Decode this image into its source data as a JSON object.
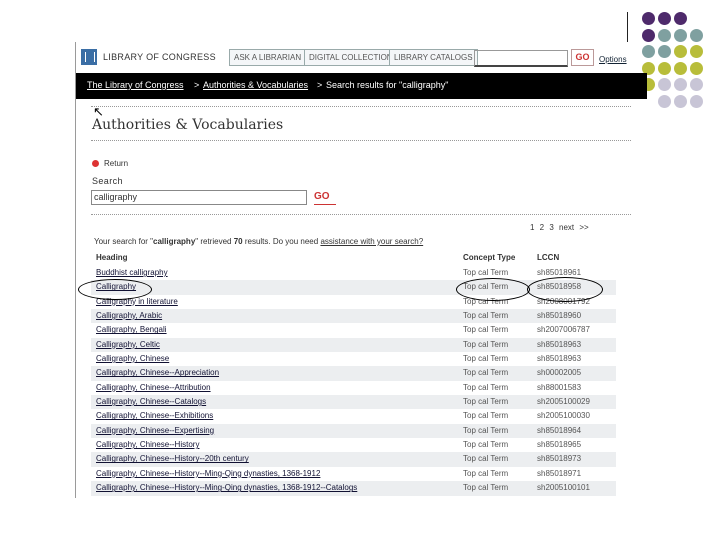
{
  "colors": {
    "purple": "#4e2a6b",
    "teal": "#7fa0a0",
    "olive": "#b8bd3a",
    "lavender": "#c8c5d6"
  },
  "header": {
    "logo_text": "LIBRARY OF CONGRESS",
    "ask": "ASK A LIBRARIAN",
    "digital": "DIGITAL COLLECTIONS",
    "catalogs": "LIBRARY CATALOGS",
    "go": "GO",
    "options": "Options"
  },
  "breadcrumb": {
    "home": "The Library of Congress",
    "sep1": ">",
    "section": "Authorities & Vocabularies",
    "sep2": ">",
    "current": "Search results for \"calligraphy\""
  },
  "main": {
    "title": "Authorities & Vocabularies",
    "return": "Return",
    "search_label": "Search",
    "search_value": "calligraphy",
    "go": "GO"
  },
  "results": {
    "pager": "1 2 3 next >>",
    "summary_a": "Your search for \"",
    "summary_term": "calligraphy",
    "summary_b": "\" retrieved ",
    "summary_count": "70",
    "summary_c": " results. Do you need ",
    "summary_link": "assistance with your search?",
    "col_heading": "Heading",
    "col_type": "Concept Type",
    "col_lccn": "LCCN",
    "rows": [
      {
        "heading": "Buddhist calligraphy",
        "type": "Top cal Term",
        "lccn": "sh85018961"
      },
      {
        "heading": "Calligraphy",
        "type": "Top cal Term",
        "lccn": "sh85018958"
      },
      {
        "heading": "Calligraphy in literature",
        "type": "Top cal Term",
        "lccn": "sh2008001792"
      },
      {
        "heading": "Calligraphy, Arabic",
        "type": "Top cal Term",
        "lccn": "sh85018960"
      },
      {
        "heading": "Calligraphy, Bengali",
        "type": "Top cal Term",
        "lccn": "sh2007006787"
      },
      {
        "heading": "Calligraphy, Celtic",
        "type": "Top cal Term",
        "lccn": "sh85018963"
      },
      {
        "heading": "Calligraphy, Chinese",
        "type": "Top cal Term",
        "lccn": "sh85018963"
      },
      {
        "heading": "Calligraphy, Chinese--Appreciation",
        "type": "Top cal Term",
        "lccn": "sh00002005"
      },
      {
        "heading": "Calligraphy, Chinese--Attribution",
        "type": "Top cal Term",
        "lccn": "sh88001583"
      },
      {
        "heading": "Calligraphy, Chinese--Catalogs",
        "type": "Top cal Term",
        "lccn": "sh2005100029"
      },
      {
        "heading": "Calligraphy, Chinese--Exhibitions",
        "type": "Top cal Term",
        "lccn": "sh2005100030"
      },
      {
        "heading": "Calligraphy, Chinese--Expertising",
        "type": "Top cal Term",
        "lccn": "sh85018964"
      },
      {
        "heading": "Calligraphy, Chinese--History",
        "type": "Top cal Term",
        "lccn": "sh85018965"
      },
      {
        "heading": "Calligraphy, Chinese--History--20th century",
        "type": "Top cal Term",
        "lccn": "sh85018973"
      },
      {
        "heading": "Calligraphy, Chinese--History--Ming-Qing dynasties, 1368-1912",
        "type": "Top cal Term",
        "lccn": "sh85018971"
      },
      {
        "heading": "Calligraphy, Chinese--History--Ming-Qing dynasties, 1368-1912--Catalogs",
        "type": "Top cal Term",
        "lccn": "sh2005100101"
      }
    ]
  }
}
